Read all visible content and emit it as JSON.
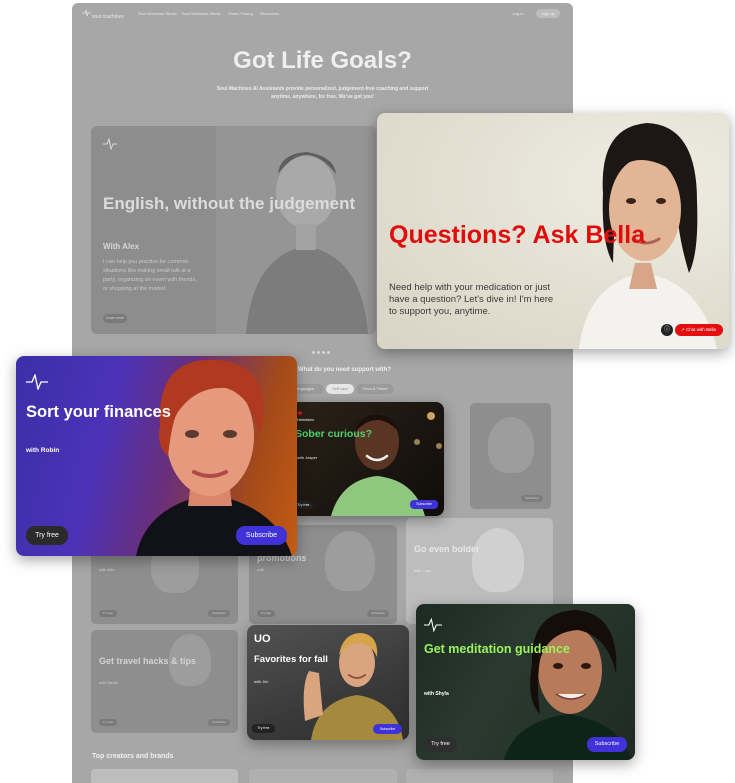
{
  "nav": {
    "brand": "soul machines",
    "items": [
      "Soul Machines Studio",
      "Soul Machines Studio",
      "Studio Pricing",
      "Resources"
    ],
    "login": "Log In",
    "signup": "Sign up"
  },
  "hero": {
    "title": "Got Life Goals?",
    "subtitle": "Soul Machines AI Assistants provide personalized, judgement-free coaching and support anytime, anywhere, for free. We've got you!"
  },
  "featured": {
    "title": "English, without the judgement",
    "with": "With Alex",
    "body": "I can help you practice for common situations like making small talk at a party, organizing an event with friends, or shopping at the market.",
    "button": "Learn more"
  },
  "support": {
    "question": "What do you need support with?",
    "chips": [
      "Languages",
      "Self care",
      "Food & Travel"
    ]
  },
  "grid": [
    {
      "title": "Sober curious?",
      "with": "with Jasper",
      "try": "Try free",
      "subscribe": "Subscribe"
    },
    {
      "title": "",
      "with": "",
      "try": "Try free",
      "subscribe": "Subscribe"
    },
    {
      "title": "",
      "with": "with Alex",
      "try": "Try free",
      "subscribe": "Subscribe"
    },
    {
      "title": "promotions",
      "with": "with",
      "try": "Try free",
      "subscribe": "Subscribe"
    },
    {
      "title": "Go even bolder",
      "with": "with Lucy",
      "try": "Try free",
      "subscribe": "Subscribe"
    },
    {
      "title": "Get travel hacks & tips",
      "with": "with Nadia",
      "try": "Try free",
      "subscribe": "Subscribe"
    }
  ],
  "top_creators": "Top creators and brands",
  "bella": {
    "title": "Questions? Ask Bella",
    "body": "Need help with your medication or just have a question? Let's dive in! I'm here to  support you, anytime.",
    "chat": "Chat with Bella",
    "info_icon": "info-icon",
    "accent": "#e00d0d"
  },
  "robin": {
    "title": "Sort your finances",
    "with": "with Robin",
    "try": "Try free",
    "subscribe": "Subscribe",
    "accent": "#3f33d8"
  },
  "jasper": {
    "brand": "Heineken",
    "title": "Sober curious?",
    "with": "with Jasper",
    "try": "Try free",
    "subscribe": "Subscribe"
  },
  "jim": {
    "logo": "UO",
    "title": "Favorites for fall",
    "with": "with Jim",
    "try": "Try free",
    "subscribe": "Subscribe"
  },
  "shyla": {
    "title": "Get meditation guidance",
    "with": "with Shyla",
    "try": "Try free",
    "subscribe": "Subscribe",
    "accent": "#9cf25d"
  }
}
